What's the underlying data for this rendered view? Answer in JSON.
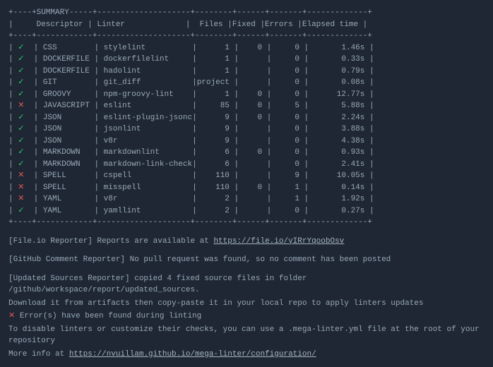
{
  "header": {
    "title": "SUMMARY",
    "cols": [
      "Descriptor",
      "Linter",
      "Files",
      "Fixed",
      "Errors",
      "Elapsed time"
    ]
  },
  "icons": {
    "pass": "✓",
    "fail": "✕",
    "ques": "?"
  },
  "rows": [
    {
      "status": "pass",
      "descriptor": "CSS",
      "linter": "stylelint",
      "files": "1",
      "fixed": "0",
      "errors": "0",
      "elapsed": "1.46s"
    },
    {
      "status": "pass",
      "descriptor": "DOCKERFILE",
      "linter": "dockerfilelint",
      "files": "1",
      "fixed": "",
      "errors": "0",
      "elapsed": "0.33s"
    },
    {
      "status": "pass",
      "descriptor": "DOCKERFILE",
      "linter": "hadolint",
      "files": "1",
      "fixed": "",
      "errors": "0",
      "elapsed": "0.79s"
    },
    {
      "status": "pass",
      "descriptor": "GIT",
      "linter": "git_diff",
      "files": "project",
      "fixed": "",
      "errors": "0",
      "elapsed": "0.08s"
    },
    {
      "status": "pass",
      "descriptor": "GROOVY",
      "linter": "npm-groovy-lint",
      "files": "1",
      "fixed": "0",
      "errors": "0",
      "elapsed": "12.77s"
    },
    {
      "status": "fail",
      "descriptor": "JAVASCRIPT",
      "linter": "eslint",
      "files": "85",
      "fixed": "0",
      "errors": "5",
      "elapsed": "5.88s"
    },
    {
      "status": "pass",
      "descriptor": "JSON",
      "linter": "eslint-plugin-jsonc",
      "files": "9",
      "fixed": "0",
      "errors": "0",
      "elapsed": "2.24s"
    },
    {
      "status": "pass",
      "descriptor": "JSON",
      "linter": "jsonlint",
      "files": "9",
      "fixed": "",
      "errors": "0",
      "elapsed": "3.88s"
    },
    {
      "status": "pass",
      "descriptor": "JSON",
      "linter": "v8r",
      "files": "9",
      "fixed": "",
      "errors": "0",
      "elapsed": "4.38s"
    },
    {
      "status": "pass",
      "descriptor": "MARKDOWN",
      "linter": "markdownlint",
      "files": "6",
      "fixed": "0",
      "errors": "0",
      "elapsed": "0.93s"
    },
    {
      "status": "pass",
      "descriptor": "MARKDOWN",
      "linter": "markdown-link-check",
      "files": "6",
      "fixed": "",
      "errors": "0",
      "elapsed": "2.41s"
    },
    {
      "status": "fail",
      "descriptor": "SPELL",
      "linter": "cspell",
      "files": "110",
      "fixed": "",
      "errors": "9",
      "elapsed": "10.05s"
    },
    {
      "status": "fail",
      "descriptor": "SPELL",
      "linter": "misspell",
      "files": "110",
      "fixed": "0",
      "errors": "1",
      "elapsed": "0.14s"
    },
    {
      "status": "fail",
      "descriptor": "YAML",
      "linter": "v8r",
      "files": "2",
      "fixed": "",
      "errors": "1",
      "elapsed": "1.92s"
    },
    {
      "status": "pass",
      "descriptor": "YAML",
      "linter": "yamllint",
      "files": "2",
      "fixed": "",
      "errors": "0",
      "elapsed": "0.27s"
    }
  ],
  "footer": {
    "fileio_prefix": "[File.io Reporter] Reports are available at ",
    "fileio_url": "https://file.io/yIRrYqoobOsv",
    "gh_comment": "[GitHub Comment Reporter] No pull request was found, so no comment has been posted",
    "updated_sources": "[Updated Sources Reporter] copied 4 fixed source files in folder /github/workspace/report/updated_sources.",
    "download_line": "Download it from artifacts then copy-paste it in your local repo to apply linters updates",
    "error_found": " Error(s) have been found during linting",
    "disable_hint": "To disable linters or customize their checks, you can use a .mega-linter.yml file at the root of your repository",
    "moreinfo_prefix": "More info at ",
    "moreinfo_url": "https://nvuillam.github.io/mega-linter/configuration/"
  },
  "_fmt": {
    "border": "+----+-            +-                     +-        +-      +-       +-             +",
    "divider": "+----+------------+----------------------+---------+-------+--------+--------------+"
  }
}
